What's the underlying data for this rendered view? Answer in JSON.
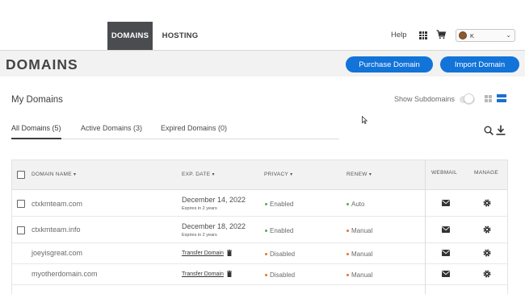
{
  "nav": {
    "tabs": [
      "DOMAINS",
      "HOSTING"
    ],
    "help": "Help",
    "account_label": "K"
  },
  "header": {
    "title": "DOMAINS",
    "purchase_button": "Purchase Domain",
    "import_button": "Import Domain"
  },
  "content": {
    "section_title": "My Domains",
    "show_subdomains_label": "Show Subdomains",
    "show_subdomains_on": false,
    "subtabs": [
      "All Domains (5)",
      "Active Domains (3)",
      "Expired Domains (0)"
    ],
    "active_subtab": "All Domains (5)"
  },
  "table": {
    "headers": {
      "domain_name": "DOMAIN NAME",
      "exp_date": "EXP. DATE",
      "privacy": "PRIVACY",
      "renew": "RENEW",
      "webmail": "WEBMAIL",
      "manage": "MANAGE"
    },
    "rows": [
      {
        "domain": "ctxkmteam.com",
        "date": "December 14, 2022",
        "sub": "Expires in 2 years",
        "privacy": "Enabled",
        "renew": "Auto"
      },
      {
        "domain": "ctxkmteam.info",
        "date": "December 18, 2022",
        "sub": "Expires in 2 years",
        "privacy": "Enabled",
        "renew": "Manual"
      },
      {
        "domain": "joeyisgreat.com",
        "transfer": "Transfer Domain",
        "privacy": "Disabled",
        "renew": "Manual"
      },
      {
        "domain": "myotherdomain.com",
        "transfer": "Transfer Domain",
        "privacy": "Disabled",
        "renew": "Manual"
      }
    ]
  },
  "colors": {
    "accent": "#1273d8",
    "nav_active_bg": "#4a4c4f",
    "header_bg": "#f2f2f3",
    "enabled_dot": "#4caf50",
    "disabled_dot": "#e8712c"
  }
}
